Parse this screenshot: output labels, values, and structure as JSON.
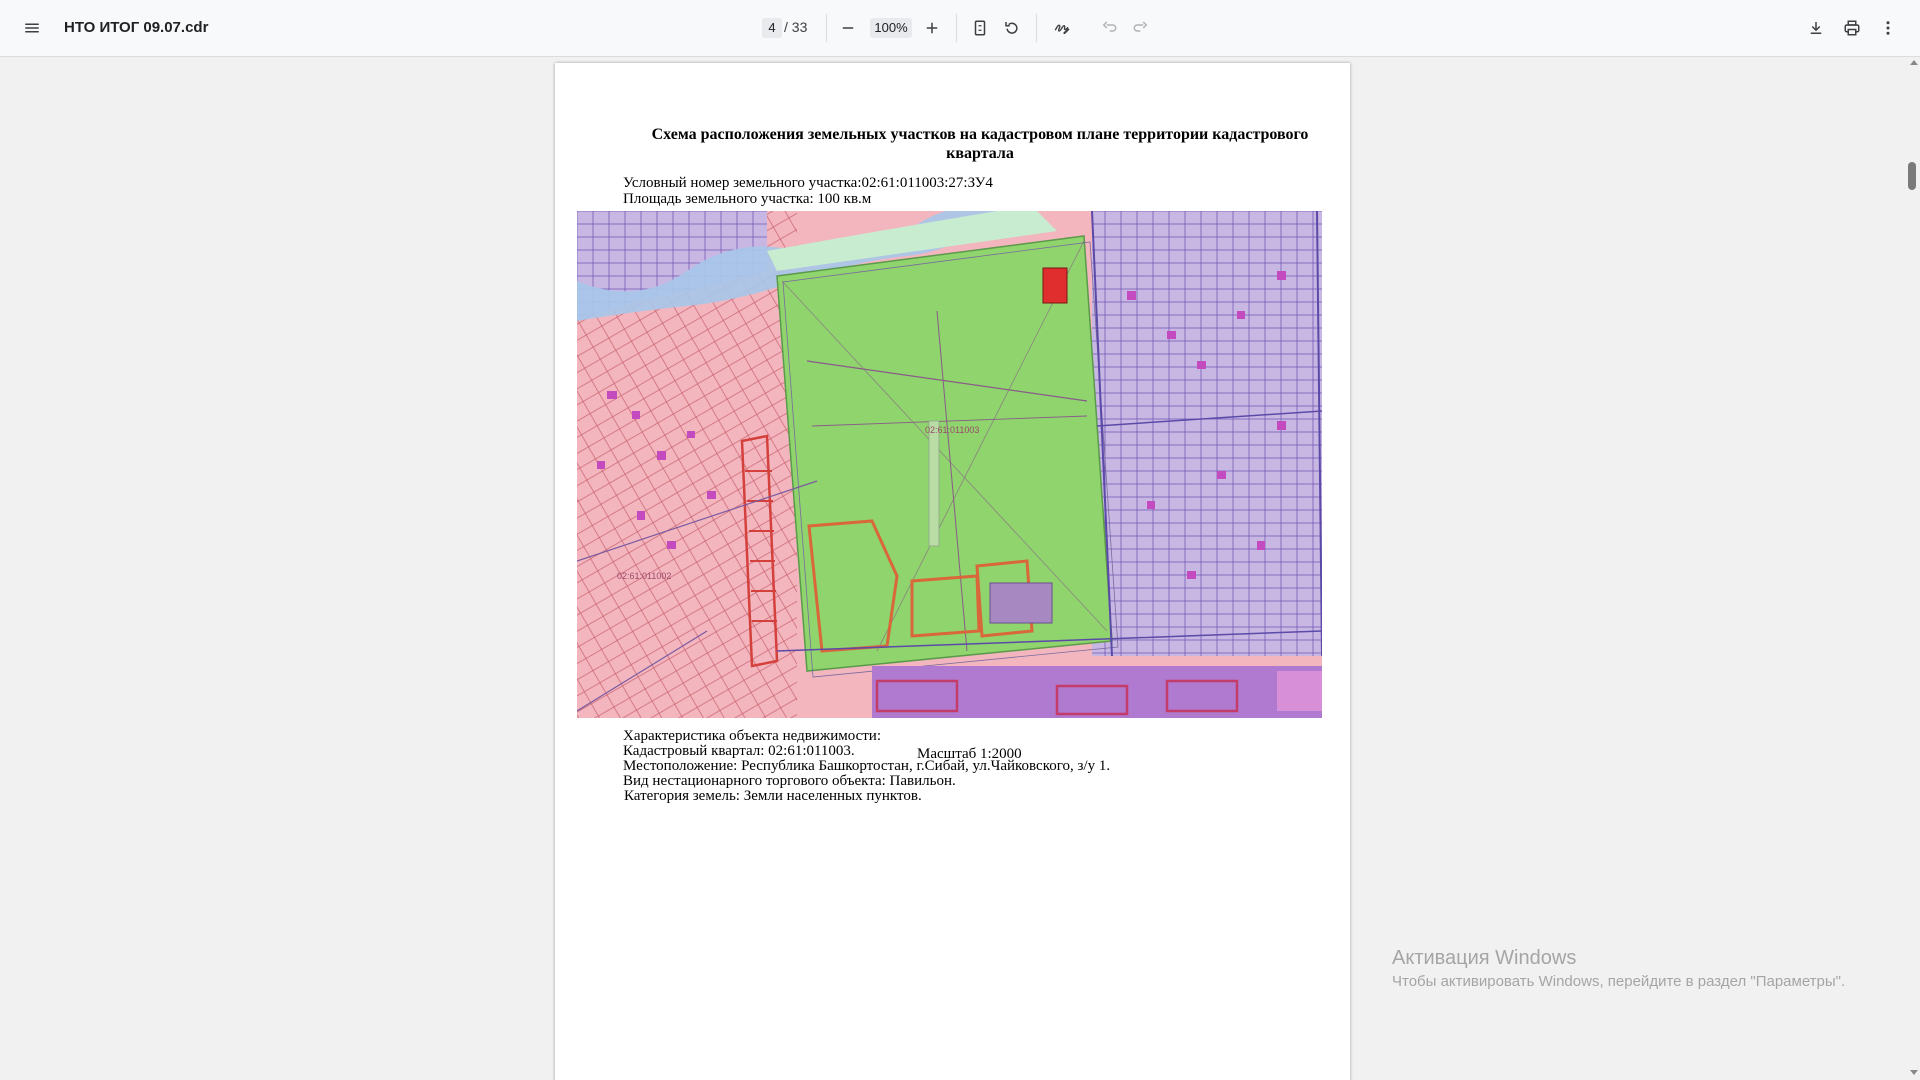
{
  "toolbar": {
    "menu_icon": "menu-icon",
    "title": "НТО ИТОГ 09.07.cdr",
    "current_page": "4",
    "total_pages": "/ 33",
    "zoom": "100%",
    "icons": [
      "zoom-out-icon",
      "zoom-in-icon",
      "fit-page-icon",
      "rotate-icon",
      "annotate-icon",
      "undo-icon",
      "redo-icon",
      "download-icon",
      "print-icon",
      "more-vert-icon"
    ]
  },
  "document": {
    "title": "Схема расположения земельных участков на кадастровом плане территории кадастрового квартала",
    "plot_number": "Условный номер земельного участка:02:61:011003:27:ЗУ4",
    "plot_area": "Площадь земельного участка: 100 кв.м",
    "map": {
      "label_quarter": "02:61:011003",
      "label_neighbor": "02:61:011002"
    },
    "scale": "Масштаб 1:2000",
    "characteristics_heading": "Характеристика объекта недвижимости:",
    "cadastral_quarter": "Кадастровый квартал: 02:61:011003.",
    "location": "Местоположение: Республика Башкортостан, г.Сибай, ул.Чайковского, з/у 1.",
    "object_type": "Вид нестационарного торгового объекта: Павильон.",
    "land_category": "Категория земель: Земли населенных пунктов."
  },
  "watermark": {
    "title": "Активация Windows",
    "subtitle": "Чтобы активировать Windows, перейдите в раздел \"Параметры\"."
  }
}
